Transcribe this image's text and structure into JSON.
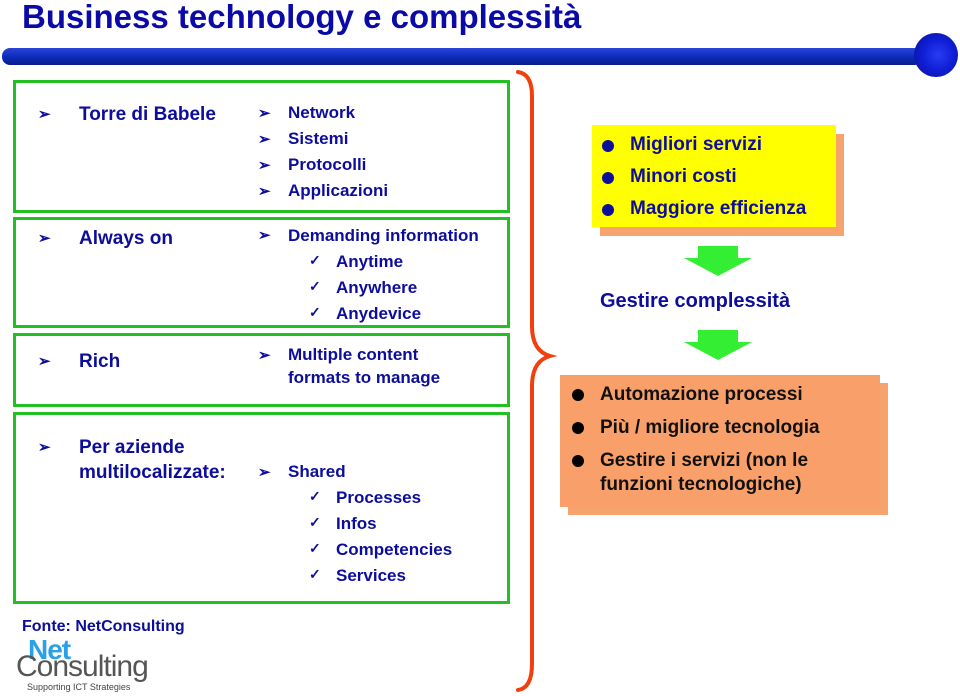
{
  "title": "Business technology e complessità",
  "left_sections": [
    {
      "label": "Torre di Babele",
      "items": [
        {
          "type": "arrow",
          "text": "Network"
        },
        {
          "type": "arrow",
          "text": "Sistemi"
        },
        {
          "type": "arrow",
          "text": "Protocolli"
        },
        {
          "type": "arrow",
          "text": "Applicazioni"
        }
      ]
    },
    {
      "label": "Always on",
      "items": [
        {
          "type": "arrow",
          "text": "Demanding information"
        },
        {
          "type": "check",
          "text": "Anytime"
        },
        {
          "type": "check",
          "text": "Anywhere"
        },
        {
          "type": "check",
          "text": "Anydevice"
        }
      ]
    },
    {
      "label": "Rich",
      "items": [
        {
          "type": "arrow",
          "text": "Multiple content"
        },
        {
          "type": "cont",
          "text": "formats to manage"
        }
      ]
    },
    {
      "label_line1": "Per aziende",
      "label_line2": "multilocalizzate:",
      "items": [
        {
          "type": "arrow",
          "text": "Shared"
        },
        {
          "type": "check",
          "text": "Processes"
        },
        {
          "type": "check",
          "text": "Infos"
        },
        {
          "type": "check",
          "text": "Competencies"
        },
        {
          "type": "check",
          "text": "Services"
        }
      ]
    }
  ],
  "benefits": [
    "Migliori servizi",
    "Minori costi",
    "Maggiore efficienza"
  ],
  "center_label": "Gestire complessità",
  "actions": [
    "Automazione processi",
    "Più / migliore tecnologia",
    "Gestire i servizi (non le",
    "funzioni tecnologiche)"
  ],
  "source": "Fonte: NetConsulting",
  "logo": {
    "part1": "Net",
    "part2": "Consulting",
    "tagline": "Supporting ICT Strategies"
  },
  "icons": {
    "arrow": "➢",
    "check": "✓"
  },
  "colors": {
    "title": "#0a0aa8",
    "text": "#0d0d9c",
    "box_border": "#22c022",
    "brace": "#f04010",
    "yellow": "#ffff00",
    "salmon": "#f9a06a",
    "arrow": "#33ee33"
  }
}
